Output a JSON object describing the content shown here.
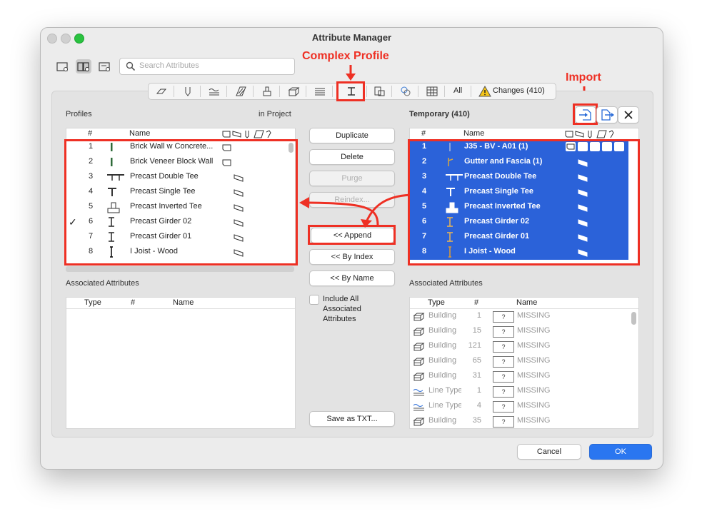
{
  "window": {
    "title": "Attribute Manager"
  },
  "search": {
    "placeholder": "Search Attributes"
  },
  "annotations": {
    "complex_profile": "Complex Profile",
    "import": "Import"
  },
  "toolbar": {
    "all_label": "All",
    "changes_label": "Changes (410)"
  },
  "left": {
    "title": "Profiles",
    "subtitle": "in Project",
    "headers": {
      "num": "#",
      "name": "Name"
    },
    "rows": [
      {
        "num": "1",
        "name": "Brick Wall w Concrete...",
        "check": "",
        "icon": "wall-profile-icon"
      },
      {
        "num": "2",
        "name": "Brick Veneer Block Wall",
        "check": "",
        "icon": "wall-profile-icon"
      },
      {
        "num": "3",
        "name": "Precast Double Tee",
        "check": "",
        "icon": "double-tee-icon"
      },
      {
        "num": "4",
        "name": "Precast Single Tee",
        "check": "",
        "icon": "single-tee-icon"
      },
      {
        "num": "5",
        "name": "Precast Inverted Tee",
        "check": "",
        "icon": "inverted-tee-icon"
      },
      {
        "num": "6",
        "name": "Precast Girder 02",
        "check": "✓",
        "icon": "girder-icon"
      },
      {
        "num": "7",
        "name": "Precast Girder 01",
        "check": "",
        "icon": "girder-icon"
      },
      {
        "num": "8",
        "name": "I Joist - Wood",
        "check": "",
        "icon": "i-joist-icon"
      }
    ],
    "assoc_title": "Associated Attributes",
    "assoc_headers": {
      "type": "Type",
      "num": "#",
      "name": "Name"
    }
  },
  "middle": {
    "duplicate": "Duplicate",
    "delete": "Delete",
    "purge": "Purge",
    "reindex": "Reindex...",
    "append": "<< Append",
    "by_index": "<< By Index",
    "by_name": "<< By Name",
    "include_all": "Include All Associated Attributes",
    "save_txt": "Save as TXT..."
  },
  "right": {
    "title": "Temporary (410)",
    "headers": {
      "num": "#",
      "name": "Name"
    },
    "rows": [
      {
        "num": "1",
        "name": "J35 - BV - A01 (1)"
      },
      {
        "num": "2",
        "name": "Gutter and Fascia  (1)"
      },
      {
        "num": "3",
        "name": "Precast Double Tee"
      },
      {
        "num": "4",
        "name": "Precast Single Tee"
      },
      {
        "num": "5",
        "name": "Precast Inverted Tee"
      },
      {
        "num": "6",
        "name": "Precast Girder 02"
      },
      {
        "num": "7",
        "name": "Precast Girder 01"
      },
      {
        "num": "8",
        "name": "I Joist - Wood"
      }
    ],
    "assoc_title": "Associated Attributes",
    "assoc_headers": {
      "type": "Type",
      "num": "#",
      "name": "Name"
    },
    "assoc_rows": [
      {
        "type": "Building",
        "num": "1",
        "q": "?",
        "name": "MISSING"
      },
      {
        "type": "Building",
        "num": "15",
        "q": "?",
        "name": "MISSING"
      },
      {
        "type": "Building",
        "num": "121",
        "q": "?",
        "name": "MISSING"
      },
      {
        "type": "Building",
        "num": "65",
        "q": "?",
        "name": "MISSING"
      },
      {
        "type": "Building",
        "num": "31",
        "q": "?",
        "name": "MISSING"
      },
      {
        "type": "Line Type",
        "num": "1",
        "q": "?",
        "name": "MISSING"
      },
      {
        "type": "Line Type",
        "num": "4",
        "q": "?",
        "name": "MISSING"
      },
      {
        "type": "Building",
        "num": "35",
        "q": "?",
        "name": "MISSING"
      }
    ]
  },
  "footer": {
    "cancel": "Cancel",
    "ok": "OK"
  },
  "colors": {
    "selection": "#2b62d9",
    "annotation": "#ee3024",
    "primary": "#2a76f0"
  }
}
